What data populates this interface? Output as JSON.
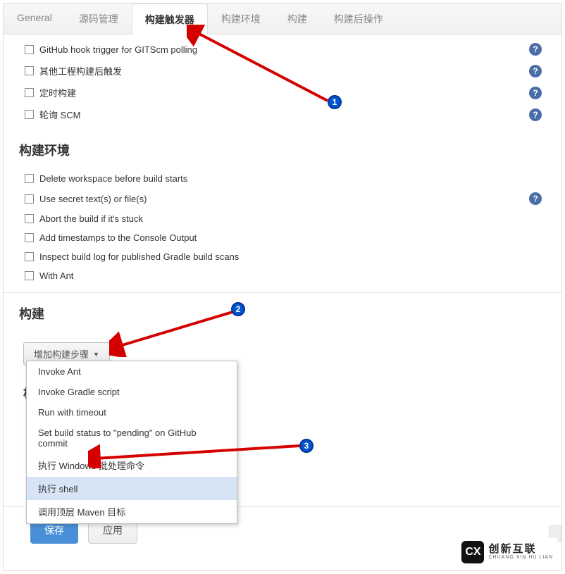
{
  "tabs": {
    "general": "General",
    "scm": "源码管理",
    "triggers": "构建触发器",
    "env": "构建环境",
    "build": "构建",
    "post": "构建后操作"
  },
  "trigger_options": {
    "github_hook": "GitHub hook trigger for GITScm polling",
    "other_project": "其他工程构建后触发",
    "scheduled": "定时构建",
    "poll_scm": "轮询 SCM"
  },
  "sections": {
    "build_env": "构建环境",
    "build": "构建",
    "cut": "枬"
  },
  "env_options": {
    "delete_ws": "Delete workspace before build starts",
    "secret": "Use secret text(s) or file(s)",
    "abort": "Abort the build if it's stuck",
    "timestamps": "Add timestamps to the Console Output",
    "gradle_scan": "Inspect build log for published Gradle build scans",
    "with_ant": "With Ant"
  },
  "buttons": {
    "add_step": "增加构建步骤",
    "save": "保存",
    "apply": "应用"
  },
  "dropdown_items": {
    "invoke_ant": "Invoke Ant",
    "gradle": "Invoke Gradle script",
    "timeout": "Run with timeout",
    "pending": "Set build status to \"pending\" on GitHub commit",
    "windows_batch": "执行 Windows 批处理命令",
    "shell": "执行 shell",
    "maven": "调用顶层 Maven 目标"
  },
  "annotations": {
    "one": "1",
    "two": "2",
    "three": "3"
  },
  "help_glyph": "?",
  "logo": {
    "mark": "CX",
    "cn": "创新互联",
    "en": "CHUANG XIN HU LIAN"
  }
}
